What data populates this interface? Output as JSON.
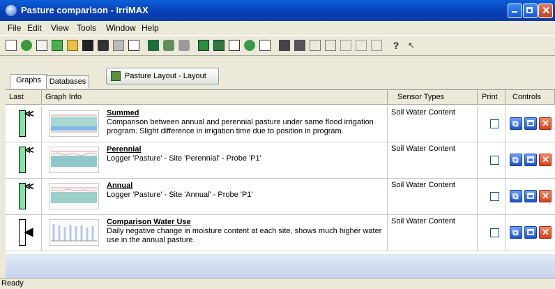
{
  "window": {
    "title": "Pasture comparison - IrriMAX"
  },
  "menu": [
    "File",
    "Edit",
    "View",
    "Tools",
    "Window",
    "Help"
  ],
  "tabs": [
    "Graphs",
    "Databases"
  ],
  "layout_button": {
    "label": "Pasture Layout - Layout"
  },
  "columns": {
    "last": "Last",
    "graph_info": "Graph Info",
    "sensor_types": "Sensor Types",
    "print": "Print",
    "controls": "Controls"
  },
  "rows": [
    {
      "name": "Summed",
      "description": "Comparison between annual and perennial pasture under same flood irrigation program. Slight difference in irrigation time due to position in program.",
      "sensor_type": "Soil Water Content"
    },
    {
      "name": "Perennial",
      "description": "Logger 'Pasture' - Site 'Perennial' - Probe 'P1'",
      "sensor_type": "Soil Water Content"
    },
    {
      "name": "Annual",
      "description": "Logger 'Pasture' - Site 'Annual' - Probe 'P1'",
      "sensor_type": "Soil Water Content"
    },
    {
      "name": "Comparison Water Use",
      "description": "Daily negative change in moisture content at each site, shows much higher water use in the annual pasture.",
      "sensor_type": "Soil Water Content"
    }
  ],
  "status": {
    "text": "Ready"
  },
  "toolbar_icons": [
    "new-document-icon",
    "import-icon",
    "export-icon",
    "report-icon",
    "open-folder-icon",
    "save-icon",
    "print-preview-icon",
    "print-icon",
    "calendar-icon",
    "logger-icon",
    "probe-icon",
    "sensor-icon",
    "graph-icon",
    "table-icon",
    "email-icon",
    "globe-icon",
    "chart-icon",
    "tile-horizontal-icon",
    "tile-vertical-icon",
    "arrange-icon",
    "split-icon",
    "layout-rows-icon",
    "layout-columns-icon",
    "cascade-icon",
    "help-icon",
    "context-help-icon"
  ],
  "colors": {
    "title_bar": "#0a5fd8",
    "gauge_fill": "#7fe8a0",
    "close_button": "#d8401c",
    "control_button": "#1e55d0"
  }
}
